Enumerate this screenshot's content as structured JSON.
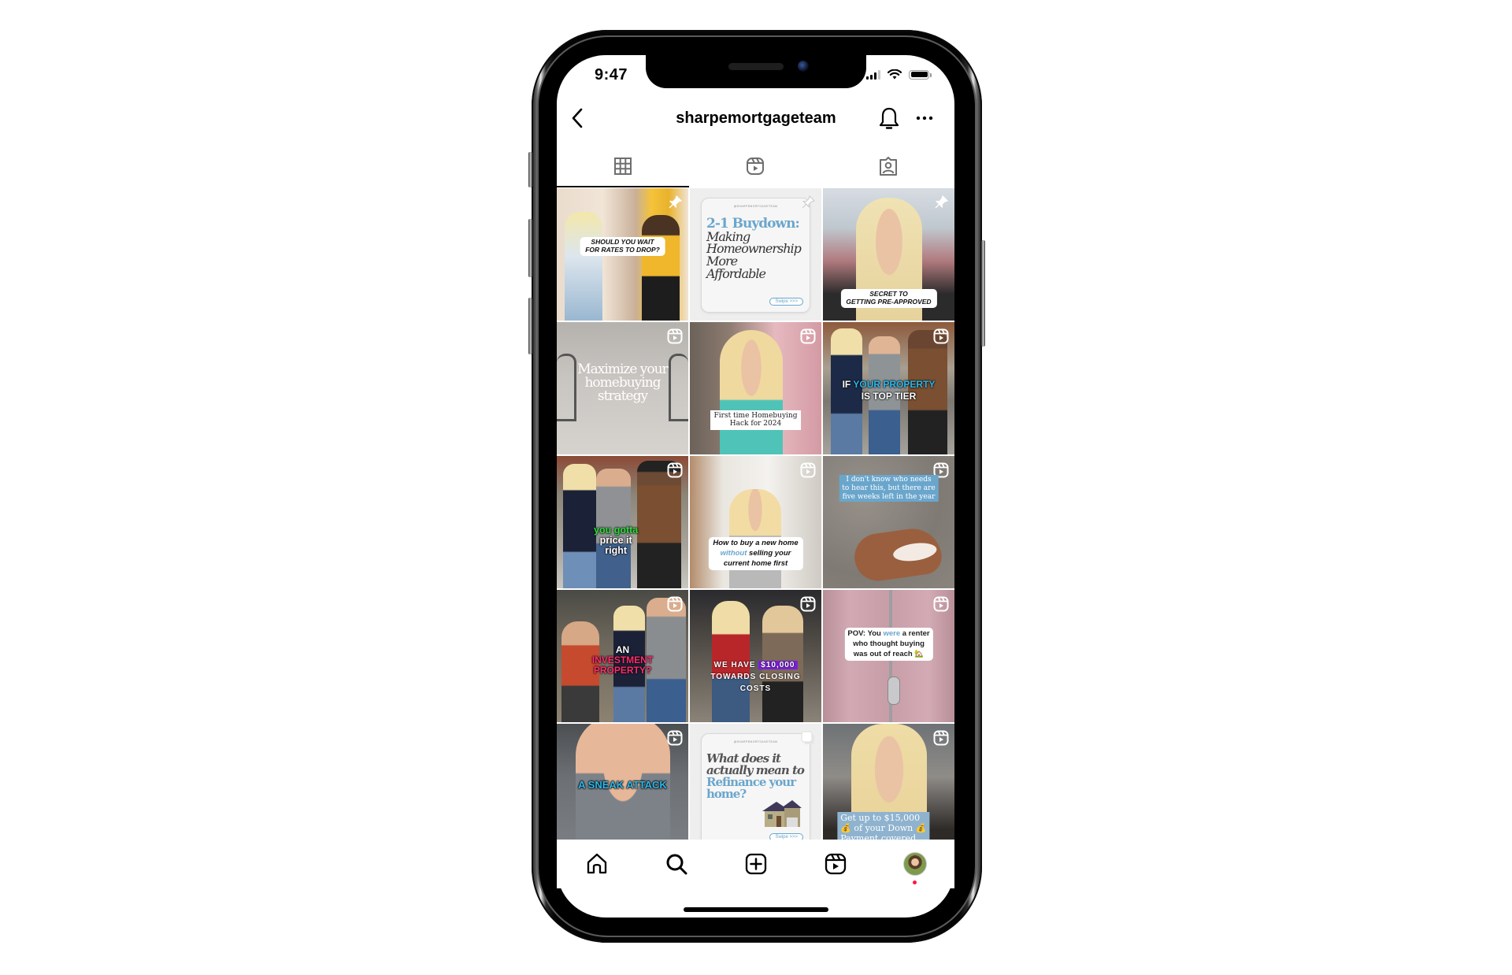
{
  "status_bar": {
    "time": "9:47",
    "signal_bars_filled": 3,
    "signal_bars_total": 4,
    "wifi": "wifi-icon",
    "battery_level": 1.0
  },
  "header": {
    "back_icon": "chevron-left-icon",
    "username": "sharpemortgageteam",
    "notifications_icon": "bell-icon",
    "more_icon": "more-horizontal-icon"
  },
  "profile_tabs": [
    {
      "name": "posts",
      "icon": "grid-icon",
      "active": true
    },
    {
      "name": "reels",
      "icon": "reels-icon",
      "active": false
    },
    {
      "name": "tagged",
      "icon": "tagged-person-icon",
      "active": false
    }
  ],
  "grid": {
    "handle_watermark": "@SHARPEMORTGAGETEAM",
    "swipe_label": "Swipe >>>",
    "posts": [
      {
        "type": "pinned-reel",
        "badge": "pin-icon",
        "caption_lines": [
          "SHOULD YOU WAIT",
          "FOR RATES TO DROP?"
        ]
      },
      {
        "type": "pinned-carousel",
        "badge": "pin-icon",
        "headline_accent": "2-1 Buydown:",
        "headline_lines": [
          "Making",
          "Homeownership",
          "More",
          "Affordable"
        ]
      },
      {
        "type": "pinned-reel",
        "badge": "pin-icon",
        "caption_lines": [
          "SECRET TO",
          "GETTING PRE-APPROVED"
        ]
      },
      {
        "type": "reel",
        "badge": "reels-icon",
        "caption_lines": [
          "Maximize your",
          "homebuying",
          "strategy"
        ]
      },
      {
        "type": "reel",
        "badge": "reels-icon",
        "caption_lines": [
          "First time Homebuying",
          "Hack for 2024"
        ]
      },
      {
        "type": "reel",
        "badge": "reels-icon",
        "caption_prefix": "IF ",
        "caption_highlight": "YOUR PROPERTY",
        "caption_line2": "IS TOP TIER"
      },
      {
        "type": "reel",
        "badge": "reels-icon",
        "caption_highlight": "you gotta",
        "caption_lines": [
          "price it",
          "right"
        ]
      },
      {
        "type": "reel",
        "badge": "reels-icon",
        "caption_line1": "How to buy a new home",
        "caption_highlight": "without",
        "caption_line2_rest": " selling your",
        "caption_line3": "current home first"
      },
      {
        "type": "reel",
        "badge": "reels-icon",
        "caption_lines": [
          "I don't know who needs",
          "to hear this, but there are",
          "five weeks left in the year"
        ]
      },
      {
        "type": "reel",
        "badge": "reels-icon",
        "caption_line1": "AN",
        "caption_highlight_lines": [
          "INVESTMENT",
          "PROPERTY?"
        ]
      },
      {
        "type": "reel",
        "badge": "reels-icon",
        "caption_prefix": "WE HAVE ",
        "caption_highlight": "$10,000",
        "caption_lines": [
          "TOWARDS CLOSING",
          "COSTS"
        ]
      },
      {
        "type": "reel",
        "badge": "reels-icon",
        "caption_prefix": "POV: You ",
        "caption_highlight": "were",
        "caption_suffix": " a renter",
        "caption_lines": [
          "who thought buying",
          "was out of reach 🏡"
        ]
      },
      {
        "type": "reel",
        "badge": "reels-icon",
        "caption_lines": [
          "A SNEAK ATTACK"
        ]
      },
      {
        "type": "carousel",
        "badge": "multiple-images-icon",
        "headline_lines": [
          "What does it",
          "actually mean to"
        ],
        "headline_accent_lines": [
          "Refinance your",
          "home?"
        ]
      },
      {
        "type": "reel",
        "badge": "reels-icon",
        "caption_lines": [
          "Get up to $15,000",
          "💰 of your Down 💰",
          "Payment covered"
        ]
      }
    ]
  },
  "bottom_nav": [
    {
      "name": "home",
      "icon": "home-icon"
    },
    {
      "name": "search",
      "icon": "search-icon"
    },
    {
      "name": "create",
      "icon": "plus-square-icon"
    },
    {
      "name": "reels",
      "icon": "reels-icon"
    },
    {
      "name": "profile",
      "icon": "profile-avatar",
      "notification_dot": true
    }
  ],
  "colors": {
    "accent_blue": "#6aa6cc",
    "highlight_cyan": "#2ab8ec",
    "highlight_green": "#2cdd3a",
    "highlight_pink": "#ff2d6e",
    "highlight_purple": "#7b1fd8",
    "notification_red": "#ff1744",
    "text_primary": "#000000",
    "icon_gray": "#6e6e6e"
  }
}
